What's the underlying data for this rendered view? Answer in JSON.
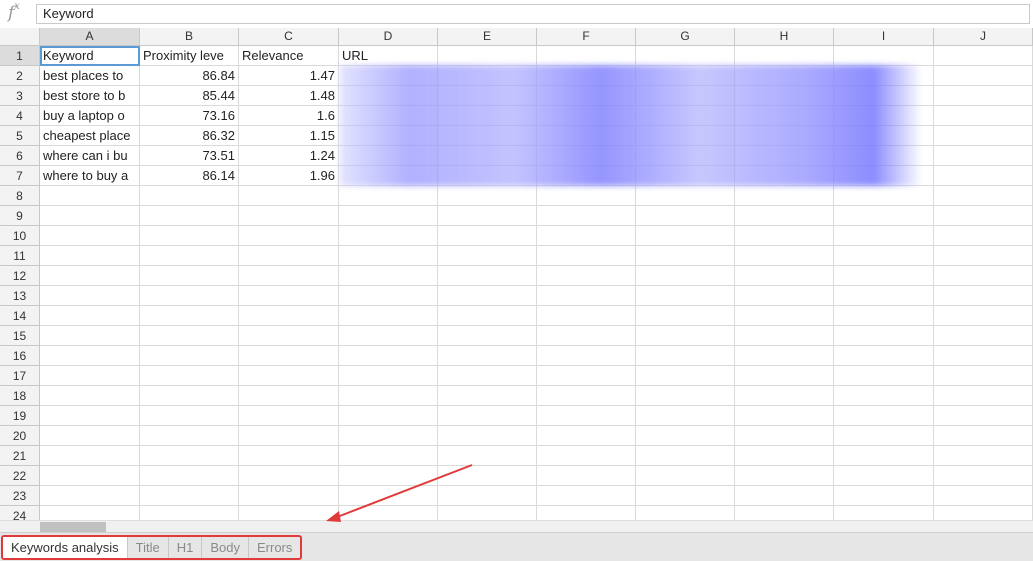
{
  "formula_bar": {
    "fx_label": "f",
    "fx_sup": "x",
    "value": "Keyword"
  },
  "columns": [
    "A",
    "B",
    "C",
    "D",
    "E",
    "F",
    "G",
    "H",
    "I",
    "J"
  ],
  "rows": [
    "1",
    "2",
    "3",
    "4",
    "5",
    "6",
    "7",
    "8",
    "9",
    "10",
    "11",
    "12",
    "13",
    "14",
    "15",
    "16",
    "17",
    "18",
    "19",
    "20",
    "21",
    "22",
    "23",
    "24"
  ],
  "cells": {
    "A1": "Keyword",
    "B1": "Proximity leve",
    "C1": "Relevance",
    "D1": "URL",
    "A2": "best places to",
    "B2": "86.84",
    "C2": "1.47",
    "A3": "best store to b",
    "B3": "85.44",
    "C3": "1.48",
    "A4": "buy a laptop o",
    "B4": "73.16",
    "C4": "1.6",
    "A5": "cheapest place",
    "B5": "86.32",
    "C5": "1.15",
    "A6": "where can i bu",
    "B6": "73.51",
    "C6": "1.24",
    "A7": "where to buy a",
    "B7": "86.14",
    "C7": "1.96"
  },
  "sheet_tabs": [
    "Keywords analysis",
    "Title",
    "H1",
    "Body",
    "Errors"
  ],
  "active_tab": "Keywords analysis",
  "annotation": {
    "highlight_color": "#e03a3a"
  }
}
